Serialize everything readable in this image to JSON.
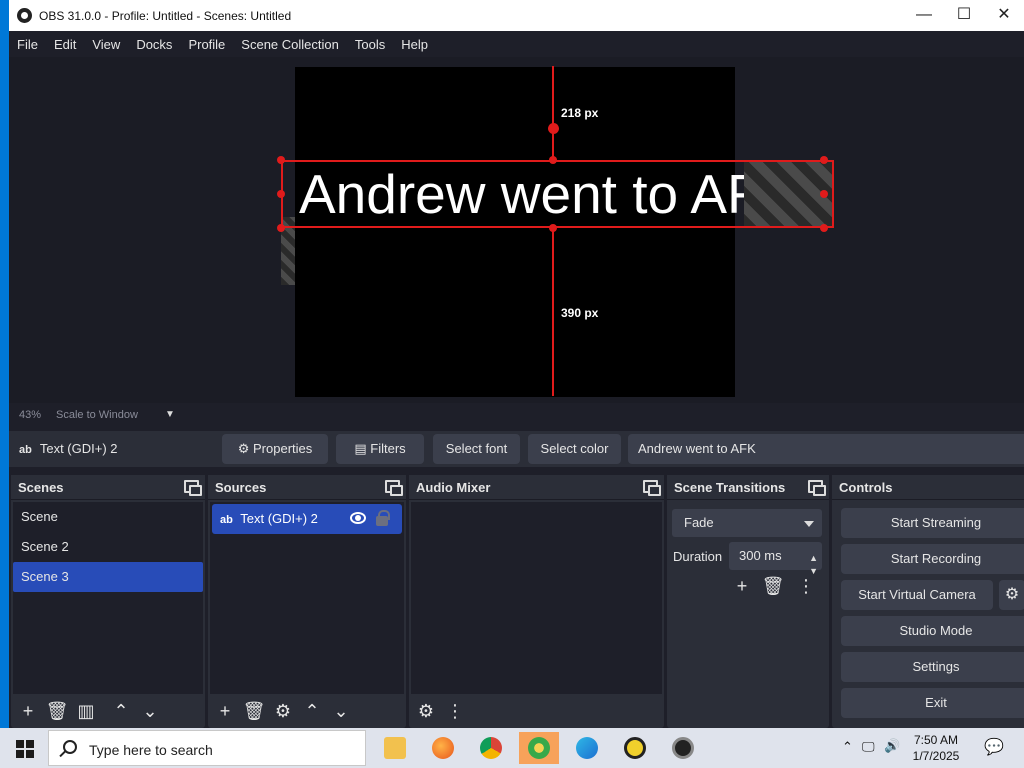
{
  "window": {
    "title": "OBS 31.0.0 - Profile: Untitled - Scenes: Untitled"
  },
  "menu": [
    "File",
    "Edit",
    "View",
    "Docks",
    "Profile",
    "Scene Collection",
    "Tools",
    "Help"
  ],
  "preview": {
    "text": "Andrew went to AFK",
    "top_distance_label": "218 px",
    "bottom_distance_label": "390 px",
    "zoom_label": "43%",
    "scale_mode": "Scale to Window"
  },
  "source_toolbar": {
    "source_name": "Text (GDI+) 2",
    "text_icon": "ab",
    "properties": "Properties",
    "filters": "Filters",
    "select_font": "Select font",
    "select_color": "Select color",
    "text_value": "Andrew went to AFK"
  },
  "scenes": {
    "title": "Scenes",
    "items": [
      "Scene",
      "Scene 2",
      "Scene 3"
    ],
    "selected": "Scene 3"
  },
  "sources": {
    "title": "Sources",
    "items": [
      {
        "icon": "ab",
        "name": "Text (GDI+) 2"
      }
    ]
  },
  "audio_mixer": {
    "title": "Audio Mixer"
  },
  "transitions": {
    "title": "Scene Transitions",
    "selected": "Fade",
    "duration_label": "Duration",
    "duration_value": "300 ms"
  },
  "controls": {
    "title": "Controls",
    "start_streaming": "Start Streaming",
    "start_recording": "Start Recording",
    "start_virtual_camera": "Start Virtual Camera",
    "studio_mode": "Studio Mode",
    "settings": "Settings",
    "exit": "Exit"
  },
  "taskbar": {
    "search_placeholder": "Type here to search",
    "time": "7:50 AM",
    "date": "1/7/2025"
  },
  "colors": {
    "accent": "#284cb8",
    "selection_red": "#e01b1b",
    "taskbar_active": "#f7a25a"
  }
}
